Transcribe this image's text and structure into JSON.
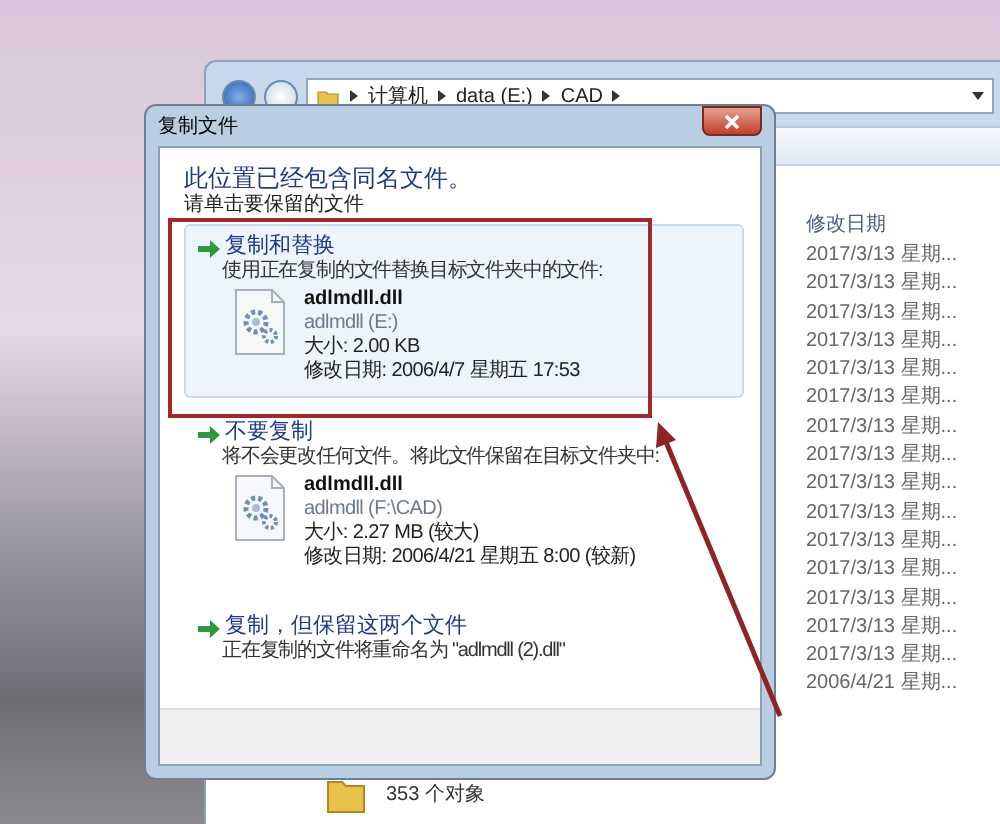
{
  "explorer": {
    "breadcrumb": [
      "计算机",
      "data (E:)",
      "CAD"
    ],
    "columns": [
      "修改日期"
    ],
    "rows": [
      {
        "modified": "2017/3/13 星期..."
      },
      {
        "modified": "2017/3/13 星期..."
      },
      {
        "modified": "2017/3/13 星期..."
      },
      {
        "modified": "2017/3/13 星期..."
      },
      {
        "modified": "2017/3/13 星期..."
      },
      {
        "modified": "2017/3/13 星期..."
      },
      {
        "modified": "2017/3/13 星期..."
      },
      {
        "modified": "2017/3/13 星期..."
      },
      {
        "modified": "2017/3/13 星期..."
      },
      {
        "modified": "2017/3/13 星期..."
      },
      {
        "modified": "2017/3/13 星期..."
      },
      {
        "modified": "2017/3/13 星期..."
      },
      {
        "modified": "2017/3/13 星期..."
      },
      {
        "modified": "2017/3/13 星期..."
      },
      {
        "modified": "2017/3/13 星期..."
      },
      {
        "modified": "2006/4/21 星期..."
      }
    ],
    "status": "353 个对象"
  },
  "dialog": {
    "title": "复制文件",
    "heading": "此位置已经包含同名文件。",
    "instruction": "请单击要保留的文件",
    "options": [
      {
        "title": "复制和替换",
        "description": "使用正在复制的文件替换目标文件夹中的文件:",
        "highlighted": true,
        "file": {
          "name": "adlmdll.dll",
          "location": "adlmdll (E:)",
          "size": "大小: 2.00 KB",
          "modified": "修改日期: 2006/4/7 星期五 17:53"
        }
      },
      {
        "title": "不要复制",
        "description": "将不会更改任何文件。将此文件保留在目标文件夹中:",
        "highlighted": false,
        "file": {
          "name": "adlmdll.dll",
          "location": "adlmdll (F:\\CAD)",
          "size": "大小: 2.27 MB (较大)",
          "modified": "修改日期: 2006/4/21 星期五 8:00 (较新)"
        }
      },
      {
        "title": "复制，但保留这两个文件",
        "description": "正在复制的文件将重命名为 \"adlmdll (2).dll\"",
        "highlighted": false
      }
    ]
  }
}
